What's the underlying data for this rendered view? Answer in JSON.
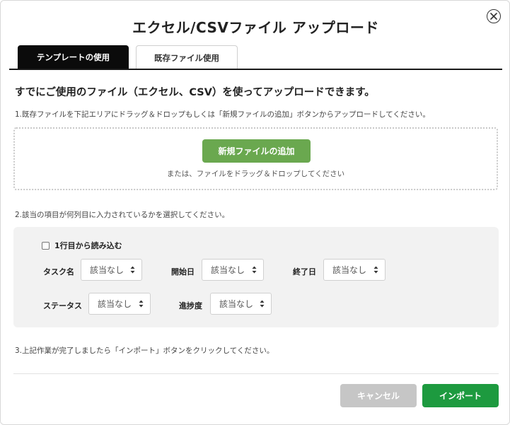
{
  "dialog": {
    "title": "エクセル/CSVファイル アップロード"
  },
  "tabs": [
    {
      "label": "テンプレートの使用",
      "active": false
    },
    {
      "label": "既存ファイル使用",
      "active": true
    }
  ],
  "headline": "すでにご使用のファイル（エクセル、CSV）を使ってアップロードできます。",
  "steps": {
    "step1": "1.既存ファイルを下記エリアにドラッグ＆ドロップもしくは「新規ファイルの追加」ボタンからアップロードしてください。",
    "step2": "2.該当の項目が何列目に入力されているかを選択してください。",
    "step3": "3.上記作業が完了しましたら「インポート」ボタンをクリックしてください。"
  },
  "dropzone": {
    "add_button": "新規ファイルの追加",
    "hint": "または、ファイルをドラッグ＆ドロップしてください"
  },
  "mapping": {
    "checkbox_label": "1行目から読み込む",
    "checkbox_checked": false,
    "fields": [
      {
        "label": "タスク名",
        "value": "該当なし"
      },
      {
        "label": "開始日",
        "value": "該当なし"
      },
      {
        "label": "終了日",
        "value": "該当なし"
      },
      {
        "label": "ステータス",
        "value": "該当なし"
      },
      {
        "label": "進捗度",
        "value": "該当なし"
      }
    ]
  },
  "footer": {
    "cancel_label": "キャンセル",
    "import_label": "インポート"
  },
  "colors": {
    "add_button": "#6aa84f",
    "import_button": "#1d9a3f",
    "cancel_button": "#c6c6c6",
    "active_tab": "#0b0b0b"
  },
  "icons": {
    "close": "close-icon",
    "select_arrows": "sort-arrows-icon"
  }
}
